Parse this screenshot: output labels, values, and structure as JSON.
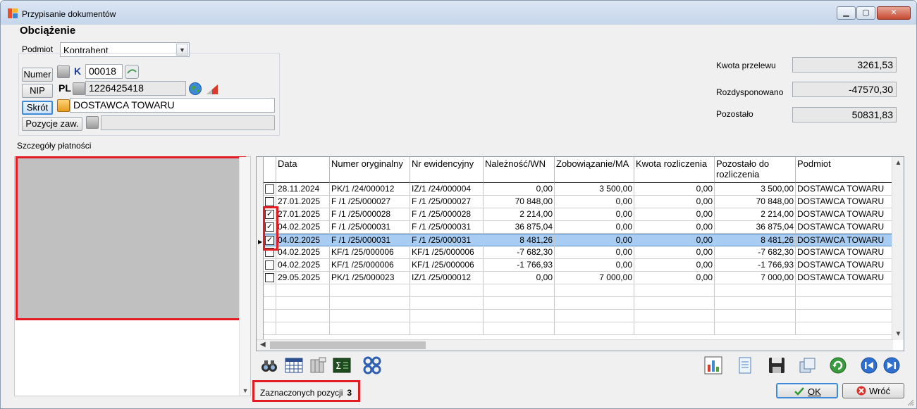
{
  "window": {
    "title": "Przypisanie dokumentów"
  },
  "form": {
    "section_title": "Obciążenie",
    "podmiot_label": "Podmiot",
    "podmiot_value": "Kontrahent",
    "numer_button": "Numer",
    "numer_prefix": "K",
    "numer_value": "00018",
    "nip_button": "NIP",
    "nip_prefix": "PL",
    "nip_value": "1226425418",
    "skrot_button": "Skrót",
    "skrot_value": "DOSTAWCA TOWARU",
    "pozycje_button": "Pozycje zaw.",
    "pozycje_value": ""
  },
  "summary": {
    "kwota_przelewu_label": "Kwota przelewu",
    "kwota_przelewu_value": "3261,53",
    "rozdysponowano_label": "Rozdysponowano",
    "rozdysponowano_value": "-47570,30",
    "pozostalo_label": "Pozostało",
    "pozostalo_value": "50831,83"
  },
  "details": {
    "label": "Szczegóły płatności"
  },
  "grid": {
    "headers": [
      "Data",
      "Numer oryginalny",
      "Nr ewidencyjny",
      "Należność/WN",
      "Zobowiązanie/MA",
      "Kwota rozliczenia",
      "Pozostało do rozliczenia",
      "Podmiot"
    ],
    "rows": [
      {
        "checked": false,
        "selected": false,
        "data": "28.11.2024",
        "numer": "PK/1  /24/000012",
        "nr_ew": "IZ/1  /24/000004",
        "wn": "0,00",
        "ma": "3 500,00",
        "kwota": "0,00",
        "pozostalo": "3 500,00",
        "podmiot": "DOSTAWCA TOWARU"
      },
      {
        "checked": false,
        "selected": false,
        "data": "27.01.2025",
        "numer": "F /1  /25/000027",
        "nr_ew": "F /1  /25/000027",
        "wn": "70 848,00",
        "ma": "0,00",
        "kwota": "0,00",
        "pozostalo": "70 848,00",
        "podmiot": "DOSTAWCA TOWARU"
      },
      {
        "checked": true,
        "selected": false,
        "data": "27.01.2025",
        "numer": "F /1  /25/000028",
        "nr_ew": "F /1  /25/000028",
        "wn": "2 214,00",
        "ma": "0,00",
        "kwota": "0,00",
        "pozostalo": "2 214,00",
        "podmiot": "DOSTAWCA TOWARU"
      },
      {
        "checked": true,
        "selected": false,
        "data": "04.02.2025",
        "numer": "F /1  /25/000031",
        "nr_ew": "F /1  /25/000031",
        "wn": "36 875,04",
        "ma": "0,00",
        "kwota": "0,00",
        "pozostalo": "36 875,04",
        "podmiot": "DOSTAWCA TOWARU"
      },
      {
        "checked": true,
        "selected": true,
        "data": "04.02.2025",
        "numer": "F /1  /25/000031",
        "nr_ew": "F /1  /25/000031",
        "wn": "8 481,26",
        "ma": "0,00",
        "kwota": "0,00",
        "pozostalo": "8 481,26",
        "podmiot": "DOSTAWCA TOWARU"
      },
      {
        "checked": false,
        "selected": false,
        "data": "04.02.2025",
        "numer": "KF/1  /25/000006",
        "nr_ew": "KF/1  /25/000006",
        "wn": "-7 682,30",
        "ma": "0,00",
        "kwota": "0,00",
        "pozostalo": "-7 682,30",
        "podmiot": "DOSTAWCA TOWARU"
      },
      {
        "checked": false,
        "selected": false,
        "data": "04.02.2025",
        "numer": "KF/1  /25/000006",
        "nr_ew": "KF/1  /25/000006",
        "wn": "-1 766,93",
        "ma": "0,00",
        "kwota": "0,00",
        "pozostalo": "-1 766,93",
        "podmiot": "DOSTAWCA TOWARU"
      },
      {
        "checked": false,
        "selected": false,
        "data": "29.05.2025",
        "numer": "PK/1  /25/000023",
        "nr_ew": "IZ/1  /25/000012",
        "wn": "0,00",
        "ma": "7 000,00",
        "kwota": "0,00",
        "pozostalo": "7 000,00",
        "podmiot": "DOSTAWCA TOWARU"
      }
    ]
  },
  "toolbar_left": [
    "binoculars-icon",
    "table-filter-icon",
    "column-chooser-icon",
    "sum-icon",
    "cogs-icon"
  ],
  "toolbar_right": [
    "chart-icon",
    "document-icon",
    "save-icon",
    "copy-icon",
    "refresh-icon",
    "prev-icon",
    "next-icon"
  ],
  "status": {
    "label": "Zaznaczonych pozycji",
    "count": "3"
  },
  "buttons": {
    "ok": "OK",
    "cancel": "Wróć"
  },
  "colors": {
    "highlight": "#e31b23",
    "selection": "#a9cdf2",
    "focus": "#3c8ad8"
  }
}
